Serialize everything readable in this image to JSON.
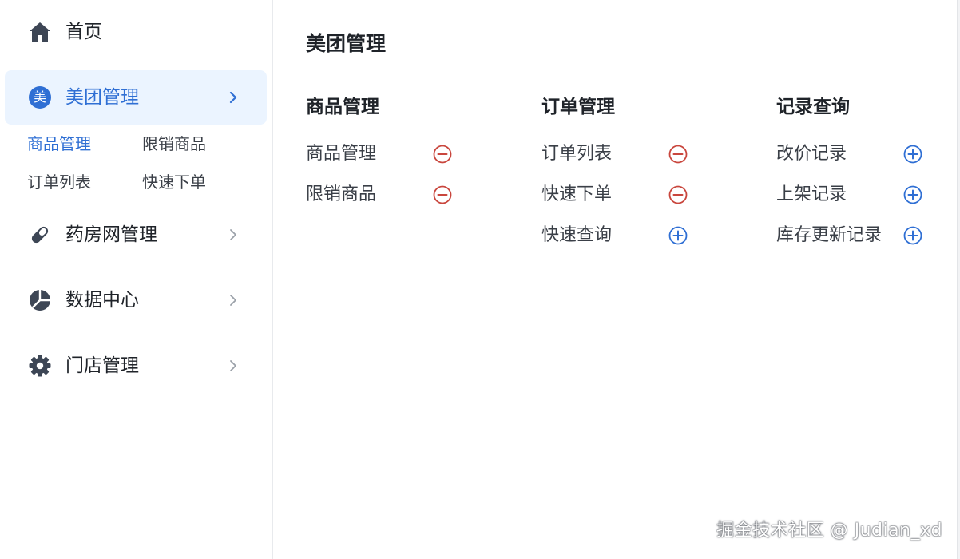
{
  "sidebar": {
    "home": {
      "label": "首页",
      "icon": "home-icon"
    },
    "meituan": {
      "label": "美团管理",
      "badge": "美",
      "icon": "meituan-badge-icon"
    },
    "meituan_sub": [
      "商品管理",
      "限销商品",
      "订单列表",
      "快速下单"
    ],
    "yaofang": {
      "label": "药房网管理",
      "icon": "pill-icon"
    },
    "data": {
      "label": "数据中心",
      "icon": "pie-chart-icon"
    },
    "store": {
      "label": "门店管理",
      "icon": "gear-icon"
    }
  },
  "main": {
    "title": "美团管理",
    "groups": [
      {
        "title": "商品管理",
        "items": [
          {
            "label": "商品管理",
            "action": "remove"
          },
          {
            "label": "限销商品",
            "action": "remove"
          }
        ]
      },
      {
        "title": "订单管理",
        "items": [
          {
            "label": "订单列表",
            "action": "remove"
          },
          {
            "label": "快速下单",
            "action": "remove"
          },
          {
            "label": "快速查询",
            "action": "add"
          }
        ]
      },
      {
        "title": "记录查询",
        "items": [
          {
            "label": "改价记录",
            "action": "add"
          },
          {
            "label": "上架记录",
            "action": "add"
          },
          {
            "label": "库存更新记录",
            "action": "add"
          }
        ]
      }
    ]
  },
  "watermark": "掘金技术社区 @ Judian_xd",
  "colors": {
    "accent": "#2f6fd4",
    "active_bg": "#ebf4ff",
    "remove": "#c9463d",
    "add": "#2f6fd4",
    "icon_dark": "#3d4655"
  }
}
